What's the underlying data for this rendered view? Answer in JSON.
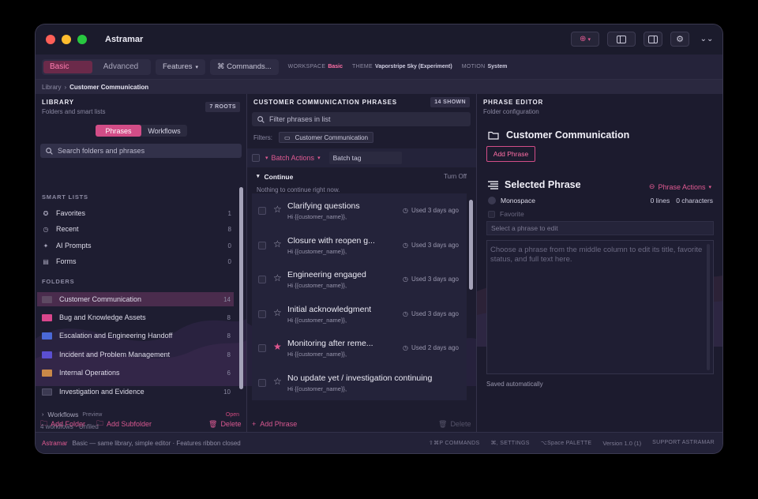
{
  "app": {
    "title": "Astramar"
  },
  "ribbon": {
    "mode_basic": "Basic",
    "mode_advanced": "Advanced",
    "features": "Features",
    "commands": "⌘ Commands...",
    "workspace_label": "WORKSPACE",
    "workspace_value": "Basic",
    "theme_label": "THEME",
    "theme_value": "Vaporstripe Sky (Experiment)",
    "motion_label": "MOTION",
    "motion_value": "System"
  },
  "breadcrumb": {
    "root": "Library",
    "sep": "›",
    "current": "Customer Communication"
  },
  "library": {
    "heading": "LIBRARY",
    "subtitle": "Folders and smart lists",
    "badge": "7 ROOTS",
    "tab_phrases": "Phrases",
    "tab_workflows": "Workflows",
    "search_placeholder": "Search folders and phrases",
    "smart_lists_label": "SMART LISTS",
    "smart_lists": [
      {
        "label": "Favorites",
        "count": "1",
        "icon": "star-circle-icon"
      },
      {
        "label": "Recent",
        "count": "8",
        "icon": "clock-icon"
      },
      {
        "label": "AI Prompts",
        "count": "0",
        "icon": "sparkle-icon"
      },
      {
        "label": "Forms",
        "count": "0",
        "icon": "form-icon"
      }
    ],
    "folders_label": "FOLDERS",
    "folders": [
      {
        "label": "Customer Communication",
        "count": "14",
        "color": "#5e4a63"
      },
      {
        "label": "Bug and Knowledge Assets",
        "count": "8",
        "color": "#d9468c"
      },
      {
        "label": "Escalation and Engineering Handoff",
        "count": "8",
        "color": "#4a68d6"
      },
      {
        "label": "Incident and Problem Management",
        "count": "8",
        "color": "#5b4fd0"
      },
      {
        "label": "Internal Operations",
        "count": "6",
        "color": "#c98848"
      },
      {
        "label": "Investigation and Evidence",
        "count": "10",
        "color": "#3c3a52"
      }
    ],
    "workflows_label": "Workflows",
    "workflows_preview": "Preview",
    "workflows_open": "Open",
    "workflows_sub": "4 workflows · Unfiled",
    "add_folder": "Add Folder",
    "add_subfolder": "Add Subfolder",
    "delete": "Delete"
  },
  "phrases": {
    "heading": "CUSTOMER COMMUNICATION PHRASES",
    "badge": "14 SHOWN",
    "filter_placeholder": "Filter phrases in list",
    "filters_label": "Filters:",
    "filter_chip": "Customer Communication",
    "batch_actions": "Batch Actions",
    "batch_tag": "Batch tag",
    "continue_label": "Continue",
    "turn_off": "Turn Off",
    "continue_empty": "Nothing to continue right now.",
    "items": [
      {
        "title": "Clarifying questions",
        "preview": "Hi {{customer_name}},",
        "used": "Used 3 days ago",
        "fav": false
      },
      {
        "title": "Closure with reopen g...",
        "preview": "Hi {{customer_name}},",
        "used": "Used 3 days ago",
        "fav": false
      },
      {
        "title": "Engineering engaged",
        "preview": "Hi {{customer_name}},",
        "used": "Used 3 days ago",
        "fav": false
      },
      {
        "title": "Initial acknowledgment",
        "preview": "Hi {{customer_name}},",
        "used": "Used 3 days ago",
        "fav": false
      },
      {
        "title": "Monitoring after reme...",
        "preview": "Hi {{customer_name}},",
        "used": "Used 2 days ago",
        "fav": true
      },
      {
        "title": "No update yet / investigation continuing",
        "preview": "Hi {{customer_name}},",
        "used": "",
        "fav": false
      }
    ],
    "add_phrase": "Add Phrase",
    "delete": "Delete"
  },
  "editor": {
    "heading": "PHRASE EDITOR",
    "subtitle": "Folder configuration",
    "folder_title": "Customer Communication",
    "add_phrase": "Add Phrase",
    "selected_title": "Selected Phrase",
    "phrase_actions": "Phrase Actions",
    "monospace": "Monospace",
    "favorite": "Favorite",
    "lines": "0 lines",
    "characters": "0 characters",
    "select_placeholder": "Select a phrase to edit",
    "body_placeholder": "Choose a phrase from the middle column to edit its title, favorite status, and full text here.",
    "saved": "Saved automatically"
  },
  "status": {
    "brand": "Astramar",
    "text": "Basic — same library, simple editor · Features ribbon closed",
    "commands": "⇧⌘P COMMANDS",
    "settings": "⌘, SETTINGS",
    "palette": "⌥Space PALETTE",
    "version": "Version 1.0 (1)",
    "support": "SUPPORT ASTRAMAR"
  },
  "colors": {
    "accent": "#e05a92",
    "bg": "#1f1f33"
  }
}
